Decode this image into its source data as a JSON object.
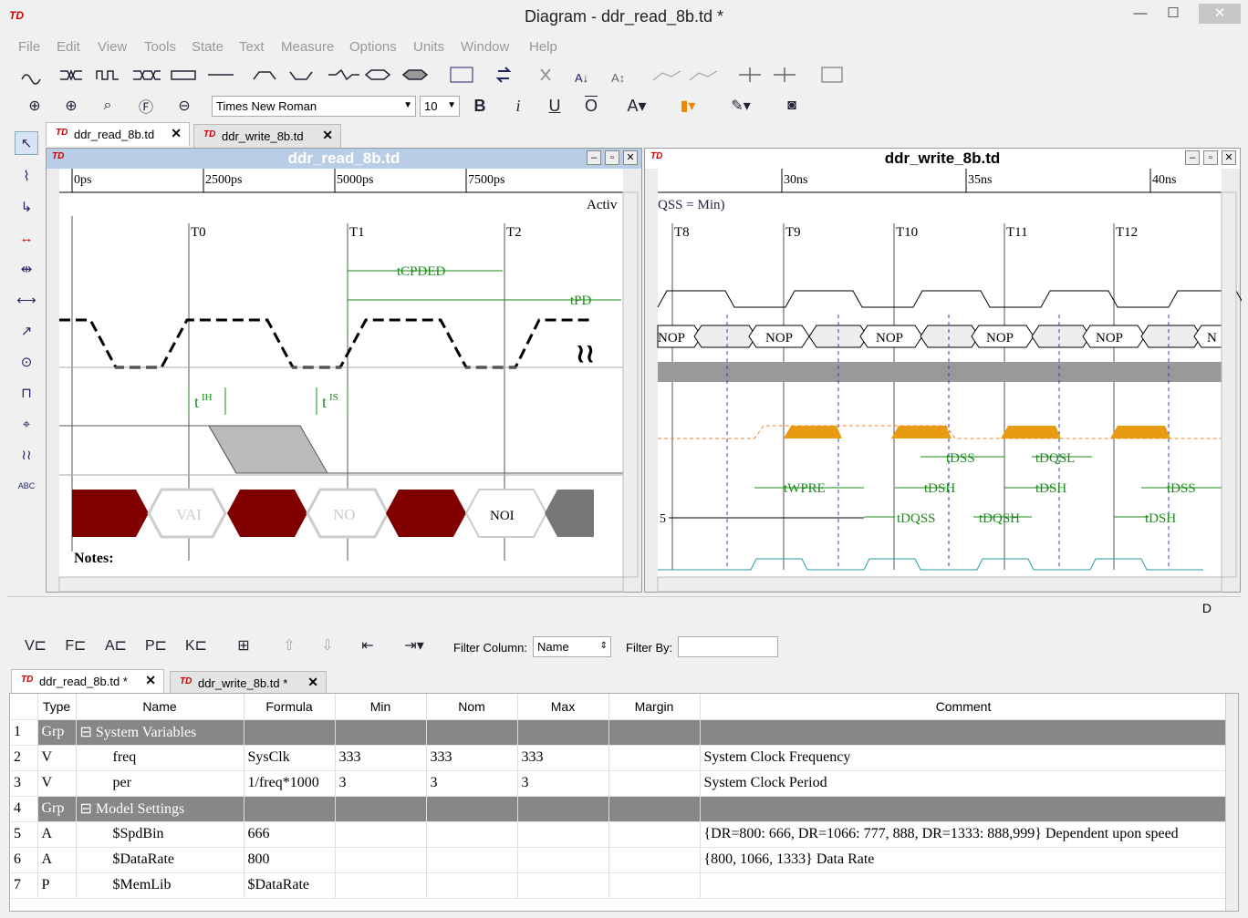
{
  "window": {
    "title": "Diagram - ddr_read_8b.td *",
    "minimize": "—",
    "maximize": "☐",
    "close": "✕"
  },
  "menu": [
    "File",
    "Edit",
    "View",
    "Tools",
    "State",
    "Text",
    "Measure",
    "Options",
    "Units",
    "Window",
    "Help"
  ],
  "format": {
    "font": "Times New Roman",
    "size": "10",
    "bold": "B",
    "italic": "i",
    "underline": "U",
    "overline": "O"
  },
  "tabs_top": [
    {
      "label": "ddr_read_8b.td"
    },
    {
      "label": "ddr_write_8b.td"
    }
  ],
  "left_pane": {
    "title": "ddr_read_8b.td",
    "ruler": [
      "0ps",
      "2500ps",
      "5000ps",
      "7500ps"
    ],
    "clocks": [
      "T0",
      "T1",
      "T2"
    ],
    "active_label": "Activ",
    "measures": [
      "tCPDED",
      "tPD"
    ],
    "setup": {
      "t": "t",
      "ih": "IH",
      "is": "IS"
    },
    "bus": [
      "VAI",
      "NO",
      "NOI"
    ],
    "notes": "Notes:"
  },
  "right_pane": {
    "title": "ddr_write_8b.td",
    "ruler": [
      "30ns",
      "35ns",
      "40ns"
    ],
    "header_text": "QSS = Min)",
    "clocks": [
      "T8",
      "T9",
      "T10",
      "T11",
      "T12"
    ],
    "bus": [
      "NOP",
      "NOP",
      "NOP",
      "NOP",
      "NOP",
      "N"
    ],
    "measures": [
      "tDSS",
      "tDQSL",
      "tWPRE",
      "tDSH",
      "tDSH",
      "tDSS",
      "tDQSS",
      "tDQSH",
      "tDSH"
    ],
    "row_marker": "5"
  },
  "status": {
    "right": "D"
  },
  "grid_toolbar": {
    "filter_column_label": "Filter Column:",
    "filter_column_value": "Name",
    "filter_by_label": "Filter By:",
    "filter_by_value": ""
  },
  "tabs_bottom": [
    {
      "label": "ddr_read_8b.td *"
    },
    {
      "label": "ddr_write_8b.td *"
    }
  ],
  "grid": {
    "columns": [
      "Type",
      "Name",
      "Formula",
      "Min",
      "Nom",
      "Max",
      "Margin",
      "Comment"
    ],
    "rows": [
      {
        "n": "1",
        "type": "Grp",
        "name": "System Variables",
        "formula": "",
        "min": "",
        "nom": "",
        "max": "",
        "margin": "",
        "comment": "",
        "group": true
      },
      {
        "n": "2",
        "type": "V",
        "name": "freq",
        "formula": "SysClk",
        "min": "333",
        "nom": "333",
        "max": "333",
        "margin": "",
        "comment": "System Clock Frequency"
      },
      {
        "n": "3",
        "type": "V",
        "name": "per",
        "formula": "1/freq*1000",
        "min": "3",
        "nom": "3",
        "max": "3",
        "margin": "",
        "comment": "System Clock Period"
      },
      {
        "n": "4",
        "type": "Grp",
        "name": "Model Settings",
        "formula": "",
        "min": "",
        "nom": "",
        "max": "",
        "margin": "",
        "comment": "",
        "group": true
      },
      {
        "n": "5",
        "type": "A",
        "name": "$SpdBin",
        "formula": "666",
        "min": "",
        "nom": "",
        "max": "",
        "margin": "",
        "comment": "{DR=800: 666, DR=1066: 777, 888, DR=1333: 888,999} Dependent upon speed"
      },
      {
        "n": "6",
        "type": "A",
        "name": "$DataRate",
        "formula": "800",
        "min": "",
        "nom": "",
        "max": "",
        "margin": "",
        "comment": "{800, 1066, 1333} Data Rate"
      },
      {
        "n": "7",
        "type": "P",
        "name": "$MemLib",
        "formula": "$DataRate",
        "min": "",
        "nom": "",
        "max": "",
        "margin": "",
        "comment": ""
      }
    ]
  }
}
